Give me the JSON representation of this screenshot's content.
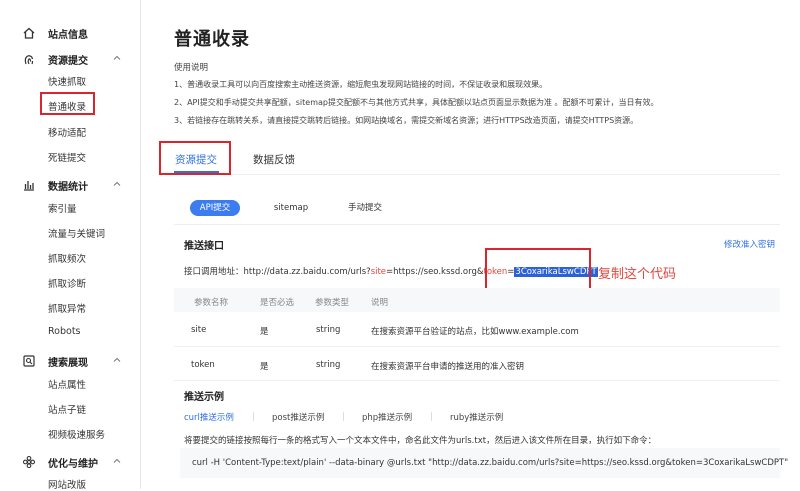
{
  "sidebar": {
    "groups": [
      {
        "label": "站点信息",
        "icon": "home-icon"
      },
      {
        "label": "资源提交",
        "icon": "fingerprint-icon"
      },
      {
        "label": "数据统计",
        "icon": "bar-chart-icon"
      },
      {
        "label": "搜索展现",
        "icon": "search-page-icon"
      },
      {
        "label": "优化与维护",
        "icon": "settings-flower-icon"
      }
    ],
    "submit_items": [
      "快速抓取",
      "普通收录",
      "移动适配",
      "死链提交"
    ],
    "stats_items": [
      "索引量",
      "流量与关键词",
      "抓取频次",
      "抓取诊断",
      "抓取异常",
      "Robots"
    ],
    "search_items": [
      "站点属性",
      "站点子链",
      "视频极速服务"
    ],
    "opt_items": [
      "网站改版"
    ]
  },
  "main": {
    "title": "普通收录",
    "usage_heading": "使用说明",
    "usage_lines": [
      "1、普通收录工具可以向百度搜索主动推送资源，缩短爬虫发现网站链接的时间，不保证收录和展现效果。",
      "2、API提交和手动提交共享配额，sitemap提交配额不与其他方式共享，具体配额以站点页面显示数据为准 。配额不可累计，当日有效。",
      "3、若链接存在跳转关系，请直接提交跳转后链接。如网站换域名，需提交新域名资源；进行HTTPS改造页面，请提交HTTPS资源。"
    ],
    "tabs": [
      "资源提交",
      "数据反馈"
    ],
    "methods": [
      "API提交",
      "sitemap",
      "手动提交"
    ],
    "push": {
      "heading": "推送接口",
      "modify_link": "修改准入密钥",
      "api_label": "接口调用地址：",
      "api_prefix": "http://data.zz.baidu.com/urls?",
      "api_site_key": "site",
      "api_mid": "=https://seo.kssd.org&",
      "api_token_key": "token",
      "api_eq": "=",
      "token_value": "3CoxarikaLswCDPT"
    },
    "annotation": "复制这个代码",
    "table": {
      "headers": [
        "参数名称",
        "是否必选",
        "参数类型",
        "说明"
      ],
      "rows": [
        [
          "site",
          "是",
          "string",
          "在搜索资源平台验证的站点，比如www.example.com"
        ],
        [
          "token",
          "是",
          "string",
          "在搜索资源平台申请的推送用的准入密钥"
        ]
      ]
    },
    "examples": {
      "heading": "推送示例",
      "tabs": [
        "curl推送示例",
        "post推送示例",
        "php推送示例",
        "ruby推送示例"
      ],
      "description": "将要提交的链接按照每行一条的格式写入一个文本文件中，命名此文件为urls.txt，然后进入该文件所在目录，执行如下命令：",
      "code": "curl -H 'Content-Type:text/plain' --data-binary @urls.txt \"http://data.zz.baidu.com/urls?site=https://seo.kssd.org&token=3CoxarikaLswCDPT\""
    }
  },
  "colors": {
    "accent": "#2f6fe0",
    "highlight_red": "#d9252b",
    "annotation_red": "#e0473d"
  }
}
